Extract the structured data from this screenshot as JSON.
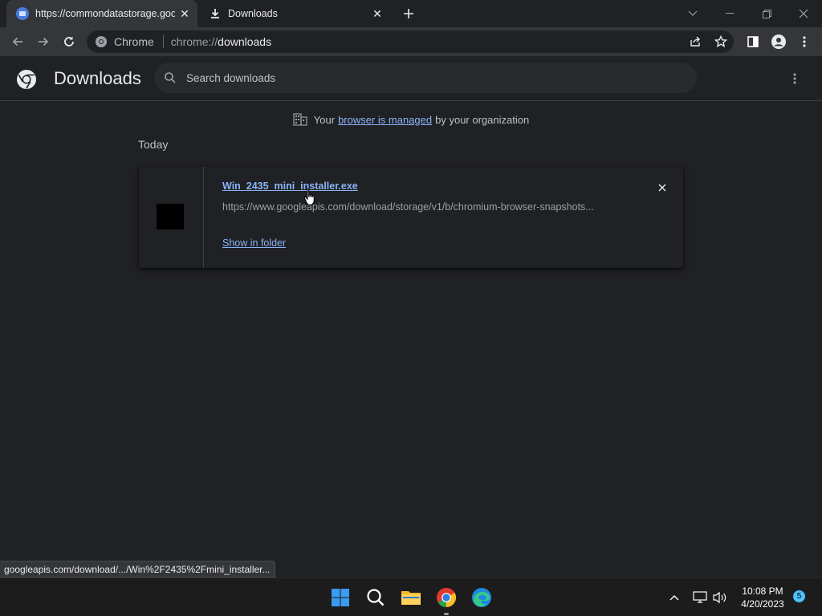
{
  "tabs": [
    {
      "label": "https://commondatastorage.goo",
      "active": true
    },
    {
      "label": "Downloads",
      "active": false
    }
  ],
  "omnibox": {
    "chip": "Chrome",
    "url_prefix": "chrome://",
    "url_host": "downloads"
  },
  "page": {
    "title": "Downloads",
    "search_placeholder": "Search downloads",
    "managed": {
      "pre": "Your",
      "link": "browser is managed",
      "post": "by your organization"
    },
    "group_label": "Today"
  },
  "download": {
    "filename": "Win_2435_mini_installer.exe",
    "source_url": "https://www.googleapis.com/download/storage/v1/b/chromium-browser-snapshots...",
    "action": "Show in folder"
  },
  "status_bar": {
    "text": "googleapis.com/download/.../Win%2F2435%2Fmini_installer..."
  },
  "taskbar": {
    "time": "10:08 PM",
    "date": "4/20/2023",
    "notification_count": "5"
  },
  "colors": {
    "accent": "#8ab4f8",
    "background": "#202124",
    "toolbar": "#35363a"
  }
}
